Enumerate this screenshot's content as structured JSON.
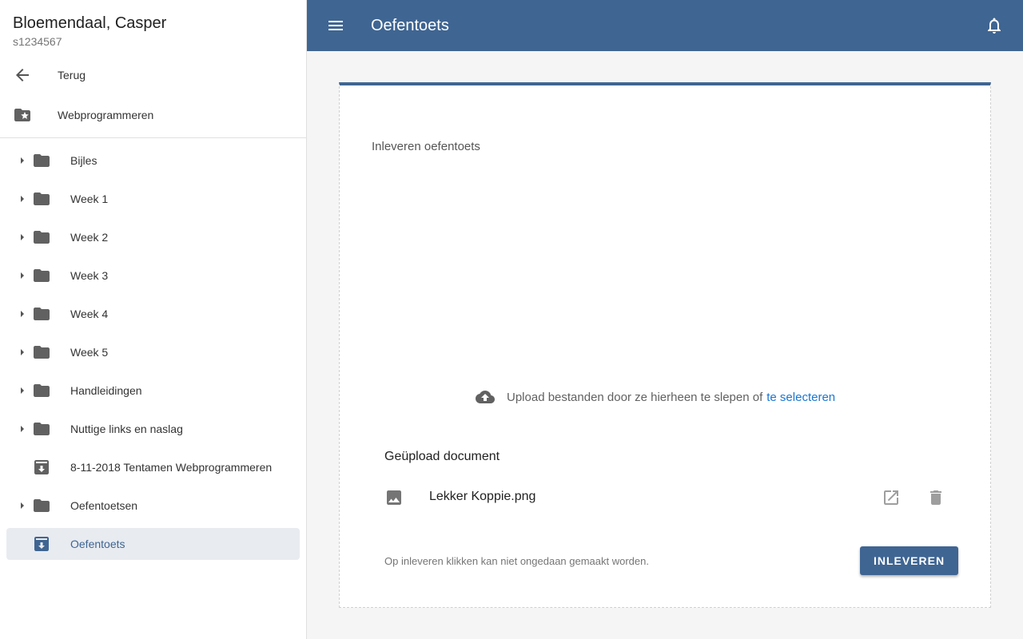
{
  "user": {
    "name": "Bloemendaal, Casper",
    "id": "s1234567"
  },
  "sidebar": {
    "back_label": "Terug",
    "course_label": "Webprogrammeren",
    "items": [
      {
        "label": "Bijles",
        "type": "folder",
        "expandable": true
      },
      {
        "label": "Week 1",
        "type": "folder",
        "expandable": true
      },
      {
        "label": "Week 2",
        "type": "folder",
        "expandable": true
      },
      {
        "label": "Week 3",
        "type": "folder",
        "expandable": true
      },
      {
        "label": "Week 4",
        "type": "folder",
        "expandable": true
      },
      {
        "label": "Week 5",
        "type": "folder",
        "expandable": true
      },
      {
        "label": "Handleidingen",
        "type": "folder",
        "expandable": true
      },
      {
        "label": "Nuttige links en naslag",
        "type": "folder",
        "expandable": true
      },
      {
        "label": "8-11-2018 Tentamen Webprogrammeren",
        "type": "assignment",
        "expandable": false
      },
      {
        "label": "Oefentoetsen",
        "type": "folder",
        "expandable": true
      },
      {
        "label": "Oefentoets",
        "type": "assignment",
        "expandable": false,
        "active": true
      }
    ]
  },
  "topbar": {
    "title": "Oefentoets"
  },
  "main": {
    "card_title": "Inleveren oefentoets",
    "upload_text": "Upload bestanden door ze hierheen te slepen of",
    "upload_link": "te selecteren",
    "uploaded_heading": "Geüpload document",
    "file_name": "Lekker Koppie.png",
    "warning_text": "Op inleveren klikken kan niet ongedaan gemaakt worden.",
    "submit_label": "INLEVEREN"
  },
  "colors": {
    "primary": "#3f6592",
    "link": "#1976d2",
    "active_bg": "#e8ebf0",
    "icon_grey": "#616161"
  }
}
